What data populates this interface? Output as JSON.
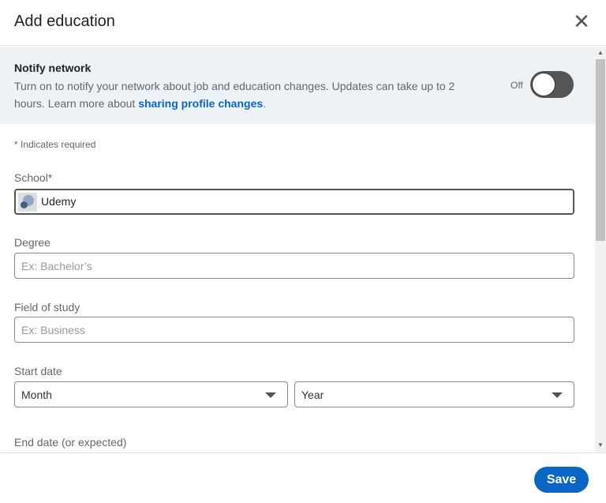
{
  "header": {
    "title": "Add education",
    "close": "✕"
  },
  "notify": {
    "title": "Notify network",
    "description": "Turn on to notify your network about job and education changes. Updates can take up to 2 hours. Learn more about ",
    "link": "sharing profile changes",
    "link_suffix": ".",
    "toggle_label": "Off",
    "toggle_on": false
  },
  "form": {
    "required_note": "* Indicates required",
    "school": {
      "label": "School*",
      "value": "Udemy"
    },
    "degree": {
      "label": "Degree",
      "placeholder": "Ex: Bachelor’s"
    },
    "field": {
      "label": "Field of study",
      "placeholder": "Ex: Business"
    },
    "start": {
      "label": "Start date",
      "month": "Month",
      "year": "Year"
    },
    "end": {
      "label": "End date (or expected)"
    }
  },
  "footer": {
    "save": "Save"
  },
  "colors": {
    "accent": "#0a66c2",
    "notify_bg": "#edf2f7"
  }
}
